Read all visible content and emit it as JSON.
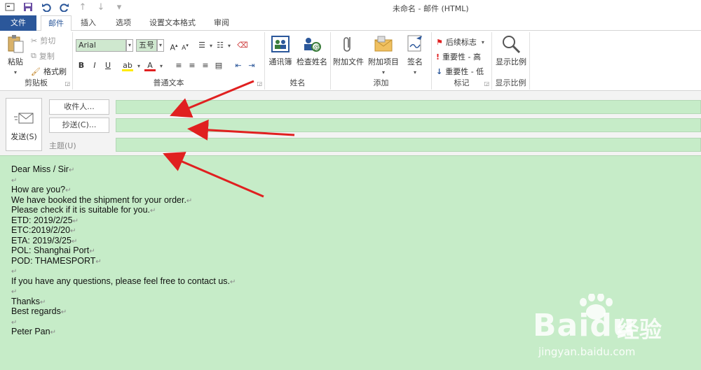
{
  "window": {
    "title": "未命名 - 邮件 (HTML)"
  },
  "tabs": {
    "file": "文件",
    "mail": "邮件",
    "insert": "插入",
    "options": "选项",
    "format": "设置文本格式",
    "review": "审阅"
  },
  "ribbon": {
    "clipboard": {
      "paste": "粘贴",
      "cut": "剪切",
      "copy": "复制",
      "format_painter": "格式刷",
      "label": "剪贴板"
    },
    "basic_text": {
      "font": "Arial",
      "size": "五号",
      "label": "普通文本"
    },
    "names": {
      "address_book": "通讯簿",
      "check_names": "检查姓名",
      "label": "姓名"
    },
    "include": {
      "attach_file": "附加文件",
      "attach_item": "附加项目",
      "signature": "签名",
      "label": "添加"
    },
    "tags": {
      "follow_up": "后续标志",
      "high": "重要性 - 高",
      "low": "重要性 - 低",
      "label": "标记"
    },
    "zoom": {
      "zoom": "显示比例",
      "label": "显示比例"
    }
  },
  "header": {
    "send": "发送(S)",
    "to": "收件人...",
    "cc": "抄送(C)...",
    "subject": "主题(U)"
  },
  "body_lines": [
    "Dear Miss / Sir",
    "",
    "How are you?",
    "We have booked the shipment for your order.",
    "Please check if it is suitable for you.",
    "ETD: 2019/2/25",
    "ETC:2019/2/20",
    "ETA: 2019/3/25",
    "POL: Shanghai Port",
    "POD: THAMESPORT",
    "",
    "If you have any questions, please feel free to contact us.",
    "",
    "Thanks",
    "Best regards",
    "",
    "Peter Pan"
  ],
  "watermark": {
    "brand": "Bai",
    "brand2": "du",
    "cn": "经验",
    "url": "jingyan.baidu.com"
  },
  "colors": {
    "accent": "#2b579a",
    "body_bg": "#c6ecc8",
    "arrow": "#e02020"
  }
}
